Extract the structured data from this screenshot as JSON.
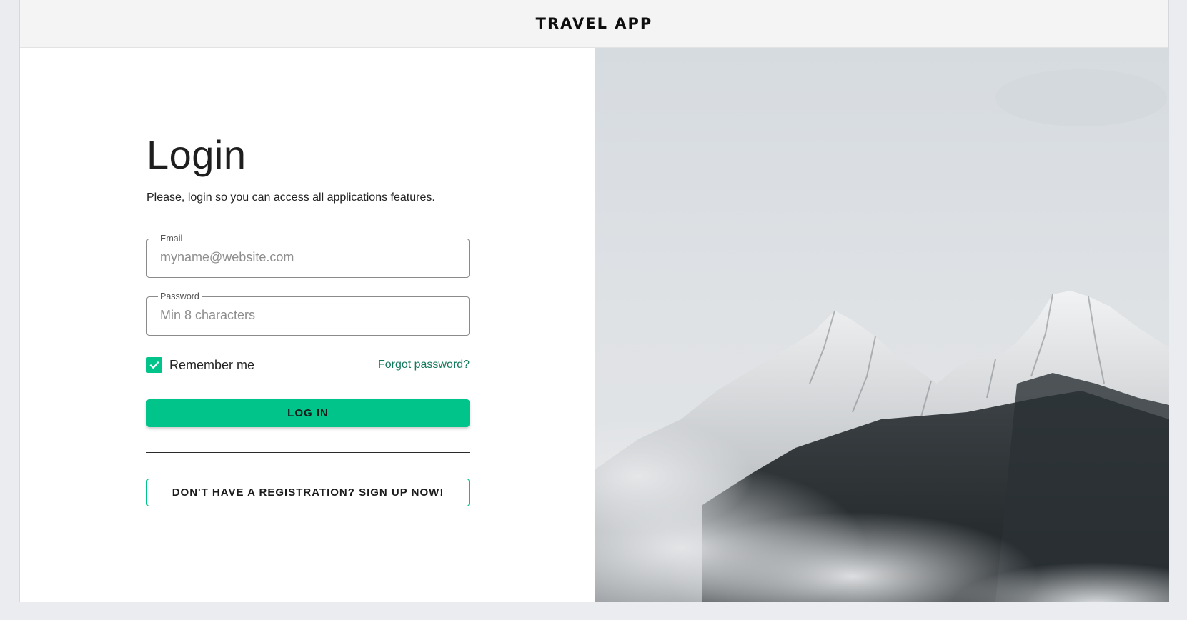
{
  "header": {
    "brand": "TRAVEL APP"
  },
  "login": {
    "title": "Login",
    "subtitle": "Please, login so you can access all applications features.",
    "email": {
      "label": "Email",
      "placeholder": "myname@website.com",
      "value": ""
    },
    "password": {
      "label": "Password",
      "placeholder": "Min 8 characters",
      "value": ""
    },
    "remember": {
      "label": "Remember me",
      "checked": true
    },
    "forgot_label": "Forgot password?",
    "login_label": "LOG IN",
    "signup_label": "DON'T HAVE A REGISTRATION? SIGN UP NOW!"
  },
  "hero": {
    "icon": "mountain-landscape-photo"
  },
  "colors": {
    "accent": "#00c48a",
    "link": "#137a5a",
    "header_bg": "#f4f4f4",
    "page_bg": "#ebecf0"
  }
}
